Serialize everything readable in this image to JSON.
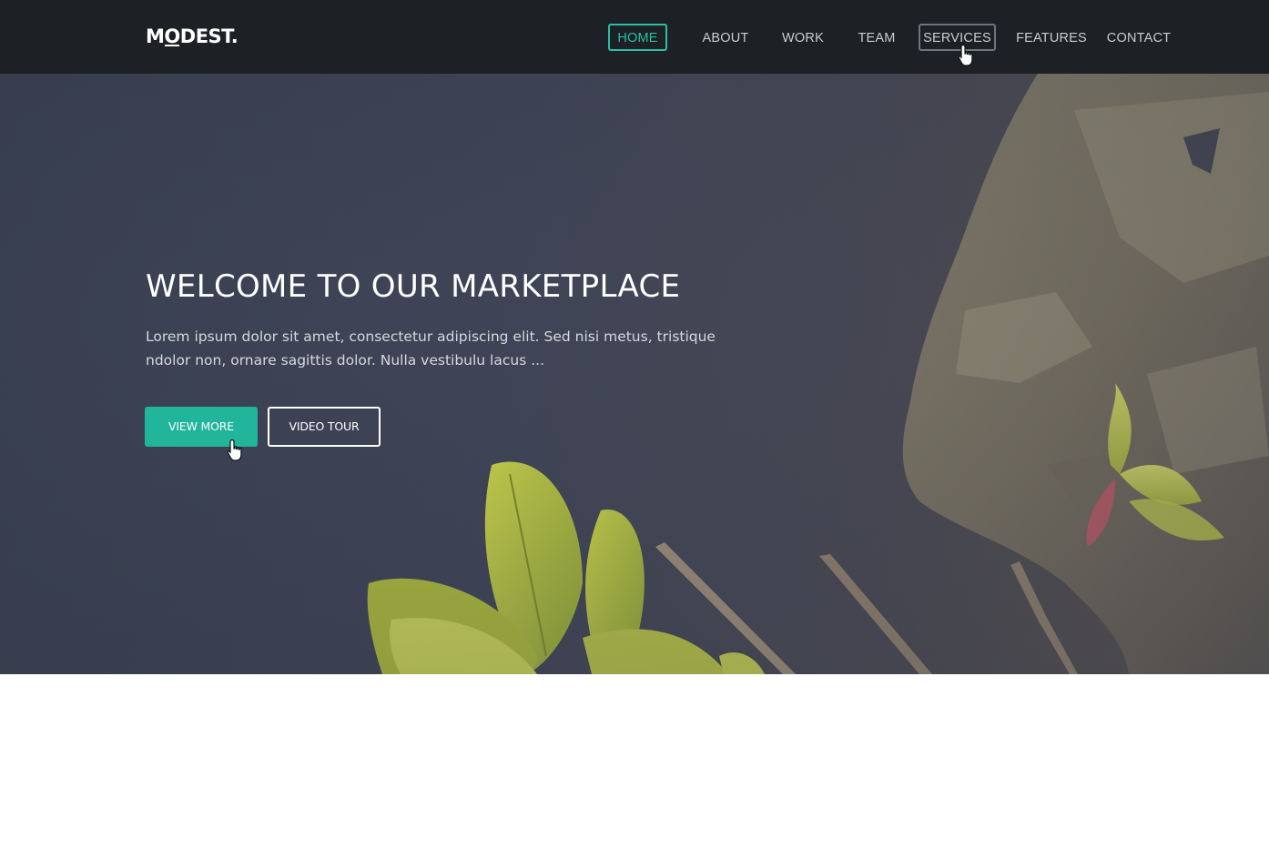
{
  "brand": {
    "logo_text_pre": "M",
    "logo_text_o": "O",
    "logo_text_post": "DEST."
  },
  "nav": {
    "items": [
      {
        "label": "HOME",
        "state": "active"
      },
      {
        "label": "ABOUT",
        "state": "normal"
      },
      {
        "label": "WORK",
        "state": "normal"
      },
      {
        "label": "TEAM",
        "state": "normal"
      },
      {
        "label": "SERVICES",
        "state": "hover"
      },
      {
        "label": "FEATURES",
        "state": "normal"
      },
      {
        "label": "CONTACT",
        "state": "normal"
      }
    ]
  },
  "hero": {
    "title": "WELCOME TO OUR MARKETPLACE",
    "text": "Lorem ipsum dolor sit amet, consectetur adipiscing elit. Sed nisi metus, tristique ndolor non, ornare sagittis dolor. Nulla vestibulu lacus ...",
    "primary_button": "VIEW MORE",
    "secondary_button": "VIDEO TOUR"
  },
  "colors": {
    "accent": "#21b59c",
    "navbar": "#1d2024",
    "hero_base": "#3f4557"
  },
  "icons": {
    "cursor": "hand-pointer-icon"
  }
}
